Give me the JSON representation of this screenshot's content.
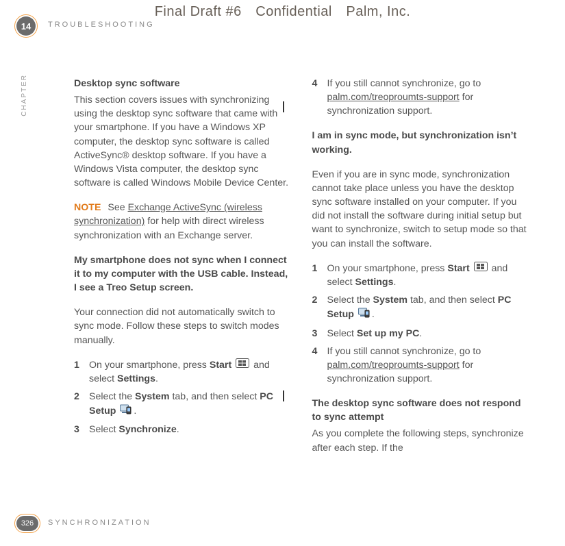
{
  "draftHeader": "Final Draft #6 Confidential Palm, Inc.",
  "chapterNum": "14",
  "sectionTop": "TROUBLESHOOTING",
  "chapterWord": "CHAPTER",
  "pageNum": "326",
  "sectionBot": "SYNCHRONIZATION",
  "left": {
    "h1": "Desktop sync software",
    "p1": "This section covers issues with synchronizing using the desktop sync software that came with your smartphone. If you have a Windows XP computer, the desktop sync software is called ActiveSync® desktop software. If you have a Windows Vista computer, the desktop sync software is called Windows Mobile Device Center.",
    "noteLabel": "NOTE",
    "noteA": " See ",
    "noteLink": "Exchange ActiveSync (wireless synchronization)",
    "noteB": " for help with direct wireless synchronization with an Exchange server.",
    "h2": "My smartphone does not sync when I connect it to my computer with the USB cable. Instead, I see a Treo Setup screen.",
    "p2": "Your connection did not automatically switch to sync mode. Follow these steps to switch modes manually.",
    "steps": [
      {
        "n": "1",
        "a": "On your smartphone, press ",
        "b1": "Start",
        "c": " and select ",
        "b2": "Settings",
        "d": "."
      },
      {
        "n": "2",
        "a": "Select the ",
        "b1": "System",
        "c": " tab, and then select ",
        "b2": "PC Setup",
        "d": "."
      },
      {
        "n": "3",
        "a": "Select ",
        "b1": "Synchronize",
        "c": "",
        "b2": "",
        "d": "."
      }
    ]
  },
  "right": {
    "step4": {
      "n": "4",
      "a": "If you still cannot synchronize, go to ",
      "link": "palm.com/treoproumts-support",
      "b": " for synchronization support."
    },
    "h1": "I am in sync mode, but synchronization isn’t working.",
    "p1": "Even if you are in sync mode, synchronization cannot take place unless you have the desktop sync software installed on your computer. If you did not install the software during initial setup but want to synchronize, switch to setup mode so that you can install the software.",
    "steps": [
      {
        "n": "1",
        "a": "On your smartphone, press ",
        "b1": "Start",
        "c": " and select ",
        "b2": "Settings",
        "d": "."
      },
      {
        "n": "2",
        "a": "Select the ",
        "b1": "System",
        "c": " tab, and then select ",
        "b2": "PC Setup",
        "d": "."
      },
      {
        "n": "3",
        "a": "Select ",
        "b1": "Set up my PC",
        "c": "",
        "b2": "",
        "d": "."
      },
      {
        "n": "4",
        "a": "If you still cannot synchronize, go to ",
        "link": "palm.com/treoproumts-support",
        "b": " for synchronization support."
      }
    ],
    "h2": "The desktop sync software does not respond to sync attempt",
    "p2": "As you complete the following steps, synchronize after each step. If the"
  }
}
